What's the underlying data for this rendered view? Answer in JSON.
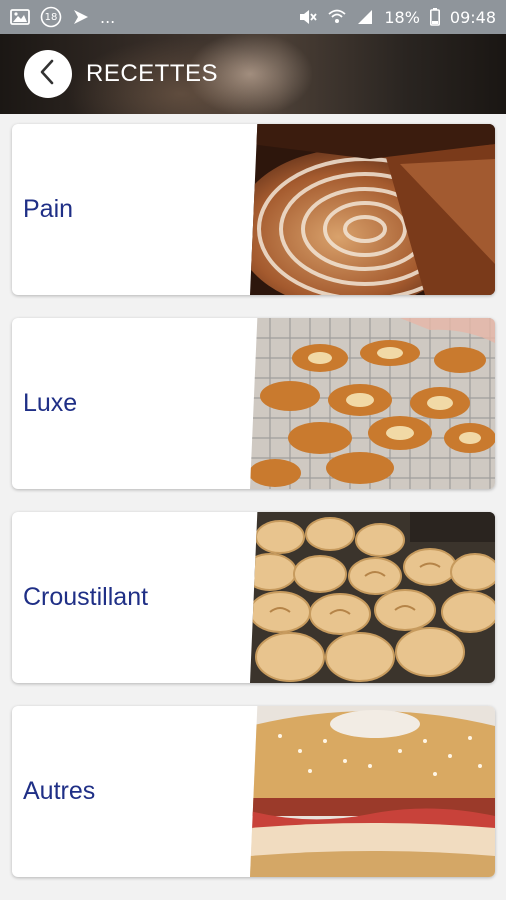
{
  "status_bar": {
    "notification_count": "18",
    "more": "...",
    "battery": "18%",
    "time": "09:48",
    "icons": [
      "image-icon",
      "notification-badge-icon",
      "store-icon",
      "mute-icon",
      "wifi-icon",
      "signal-icon",
      "battery-icon"
    ]
  },
  "header": {
    "title": "RECETTES",
    "back_icon": "chevron-left-icon"
  },
  "categories": [
    {
      "label": "Pain",
      "photo": "bread-loaf-photo"
    },
    {
      "label": "Luxe",
      "photo": "pastries-photo"
    },
    {
      "label": "Croustillant",
      "photo": "rolls-photo"
    },
    {
      "label": "Autres",
      "photo": "bagel-sandwich-photo"
    }
  ],
  "colors": {
    "label_text": "#1f2f86",
    "status_bar": "#8f959b",
    "background": "#f2f2f2"
  }
}
